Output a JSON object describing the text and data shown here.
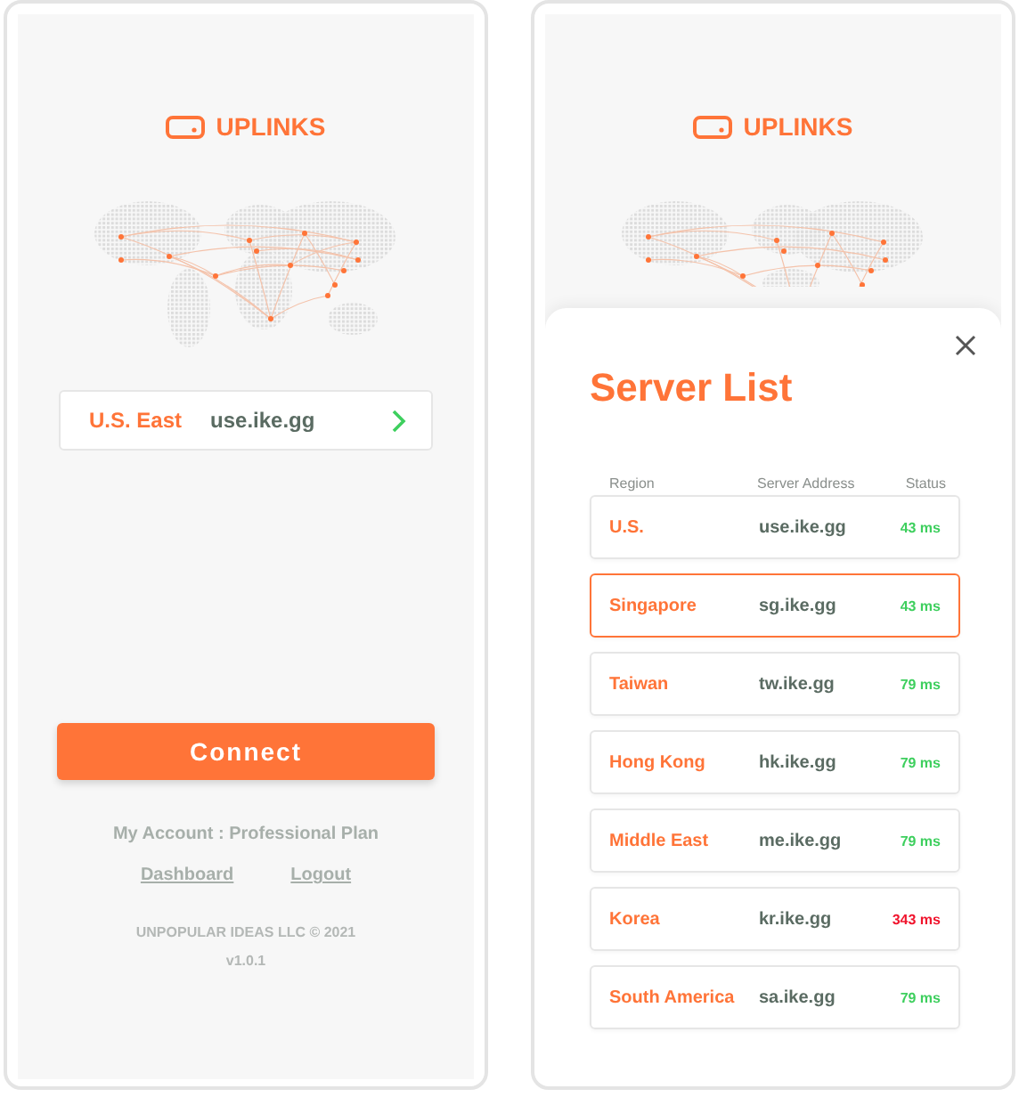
{
  "home": {
    "brand": "UPLINKS",
    "server": {
      "region": "U.S. East",
      "address": "use.ike.gg"
    },
    "connect_button": "Connect",
    "account": "My Account : Professional Plan",
    "links": [
      "Dashboard",
      "Logout"
    ],
    "copyright": "UNPOPULAR IDEAS LLC © 2021",
    "version": "v1.0.1"
  },
  "server_list": {
    "brand": "UPLINKS",
    "title": "Server List",
    "columns": [
      "Region",
      "Server Address",
      "Status"
    ],
    "rows": [
      {
        "region": "U.S.",
        "address": "use.ike.gg",
        "status": "43 ms",
        "color": "#3ecf5e",
        "selected": false
      },
      {
        "region": "Singapore",
        "address": "sg.ike.gg",
        "status": "43 ms",
        "color": "#3ecf5e",
        "selected": true
      },
      {
        "region": "Taiwan",
        "address": "tw.ike.gg",
        "status": "79 ms",
        "color": "#3ecf5e",
        "selected": false
      },
      {
        "region": "Hong Kong",
        "address": "hk.ike.gg",
        "status": "79 ms",
        "color": "#3ecf5e",
        "selected": false
      },
      {
        "region": "Middle East",
        "address": "me.ike.gg",
        "status": "79 ms",
        "color": "#3ecf5e",
        "selected": false
      },
      {
        "region": "Korea",
        "address": "kr.ike.gg",
        "status": "343 ms",
        "color": "#f0142d",
        "selected": false
      },
      {
        "region": "South America",
        "address": "sa.ike.gg",
        "status": "79 ms",
        "color": "#3ecf5e",
        "selected": false
      }
    ]
  }
}
